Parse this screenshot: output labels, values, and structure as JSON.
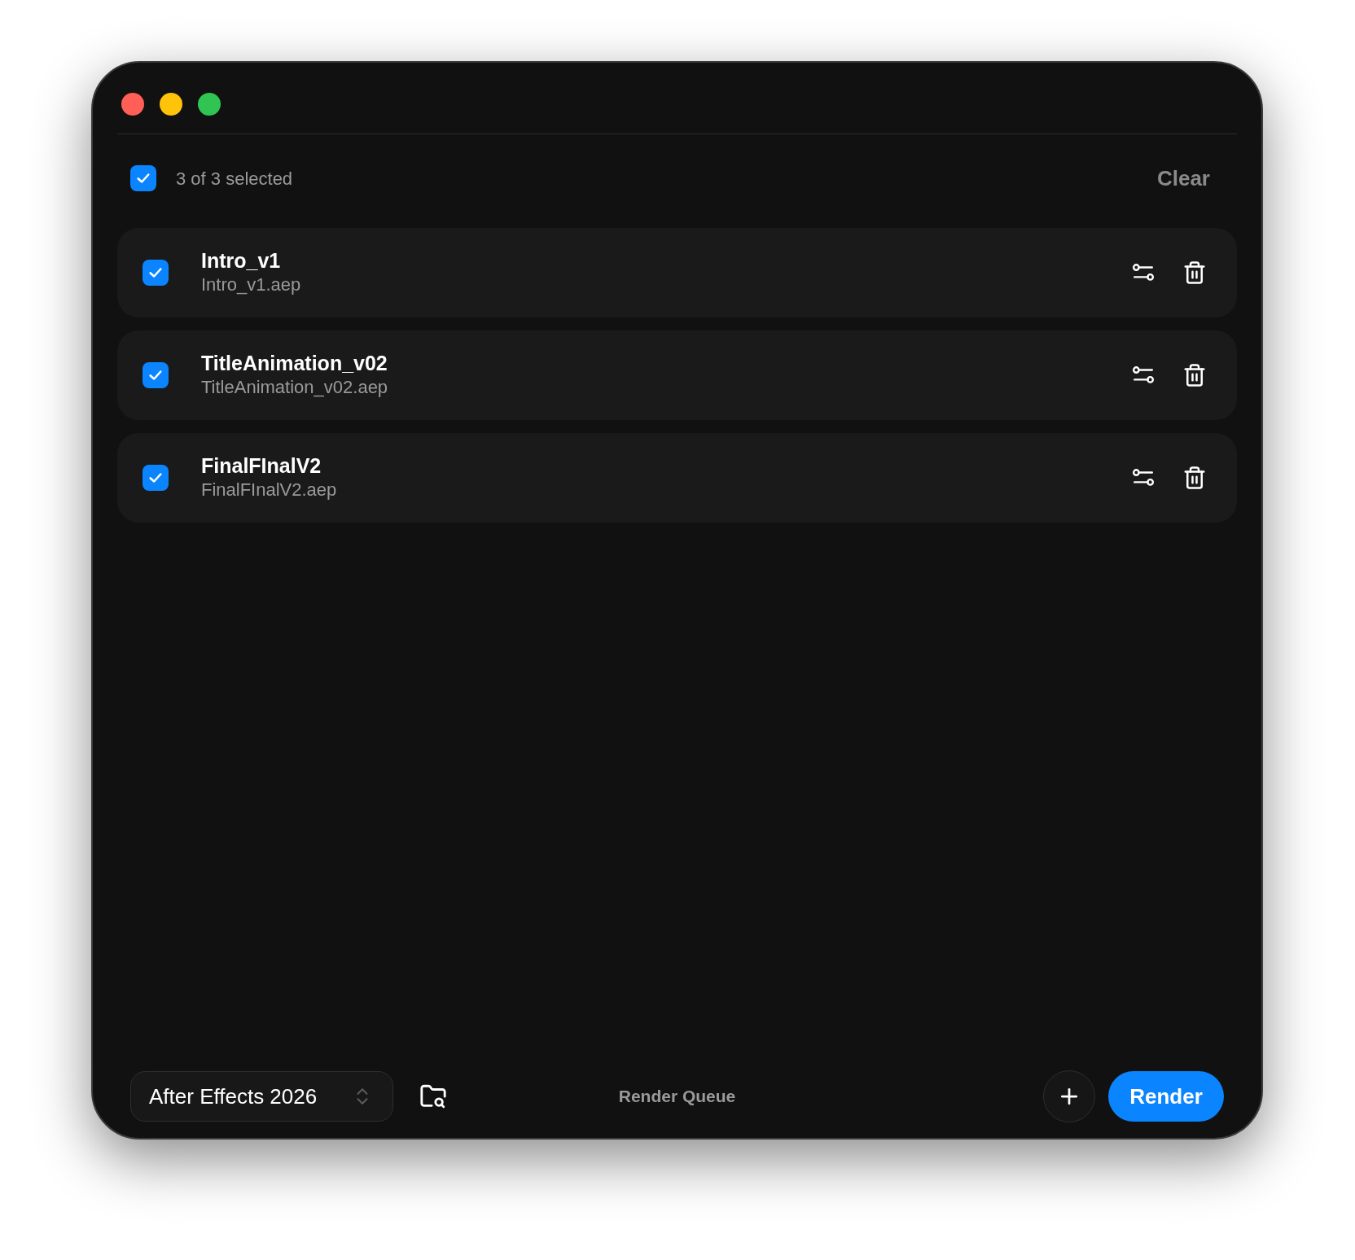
{
  "window": {
    "controls": [
      {
        "color": "#ff5f57"
      },
      {
        "color": "#ffc30a"
      },
      {
        "color": "#30c552"
      }
    ]
  },
  "header": {
    "select_all": {
      "checked": true,
      "label": "3 of 3 selected"
    },
    "clear_button": "Clear"
  },
  "items": [
    {
      "title": "Intro_v1",
      "file": "Intro_v1.aep",
      "checked": true
    },
    {
      "title": "TitleAnimation_v02",
      "file": "TitleAnimation_v02.aep",
      "checked": true
    },
    {
      "title": "FinalFInalV2",
      "file": "FinalFInalV2.aep",
      "checked": true
    }
  ],
  "footer": {
    "app_select": {
      "value": "After Effects 2026"
    },
    "title": "Render Queue",
    "render_button": "Render"
  }
}
